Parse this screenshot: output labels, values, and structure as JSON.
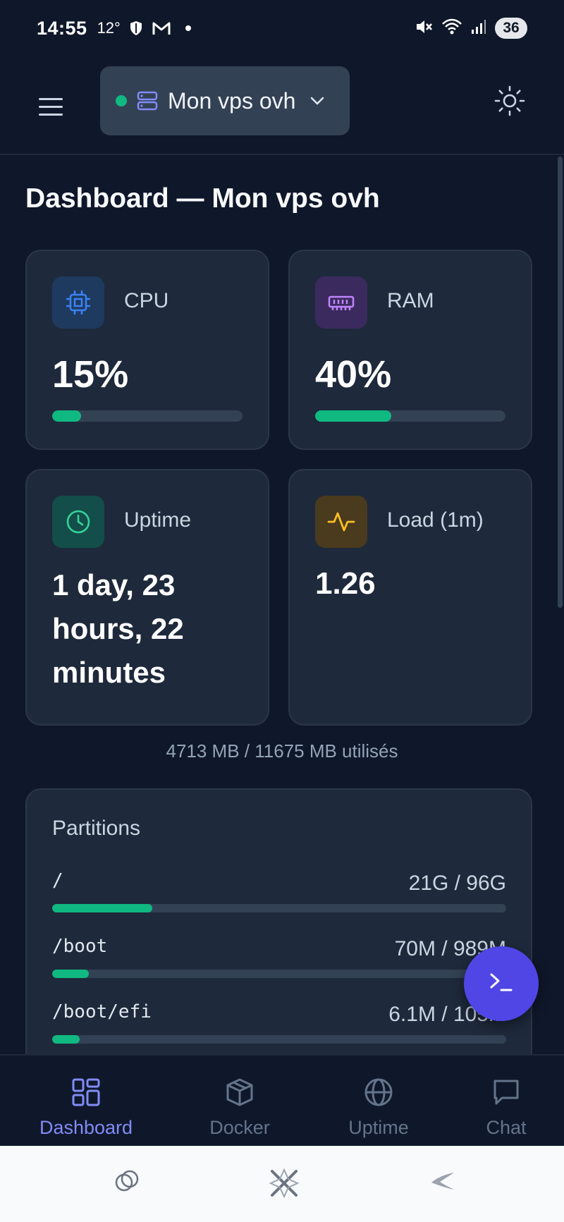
{
  "status_bar": {
    "time": "14:55",
    "temperature": "12°",
    "battery": "36"
  },
  "header": {
    "server_name": "Mon vps ovh",
    "server_status_color": "#10b981"
  },
  "page": {
    "title": "Dashboard — Mon vps ovh"
  },
  "cards": {
    "cpu": {
      "label": "CPU",
      "value": "15%",
      "percent": 15,
      "icon": "cpu-chip-icon",
      "accent": "#3b82f6"
    },
    "ram": {
      "label": "RAM",
      "value": "40%",
      "percent": 40,
      "icon": "memory-icon",
      "accent": "#a855f7"
    },
    "uptime": {
      "label": "Uptime",
      "value": "1 day, 23 hours, 22 minutes",
      "icon": "clock-icon",
      "accent": "#10b981"
    },
    "load": {
      "label": "Load (1m)",
      "value": "1.26",
      "icon": "activity-icon",
      "accent": "#f59e0b"
    }
  },
  "ram_note": "4713 MB / 11675 MB utilisés",
  "partitions": {
    "title": "Partitions",
    "items": [
      {
        "name": "/",
        "size": "21G / 96G",
        "percent": 22
      },
      {
        "name": "/boot",
        "size": "70M / 989M",
        "percent": 8
      },
      {
        "name": "/boot/efi",
        "size": "6.1M / 105M",
        "percent": 6
      }
    ]
  },
  "fab": {
    "icon": "terminal-icon"
  },
  "bottom_nav": {
    "items": [
      {
        "label": "Dashboard",
        "icon": "dashboard-icon",
        "active": true
      },
      {
        "label": "Docker",
        "icon": "docker-box-icon",
        "active": false
      },
      {
        "label": "Uptime",
        "icon": "globe-icon",
        "active": false
      },
      {
        "label": "Chat",
        "icon": "chat-icon",
        "active": false
      }
    ]
  },
  "colors": {
    "background": "#0f172a",
    "card": "#1e293b",
    "accent": "#818cf8",
    "progress": "#10b981",
    "fab": "#4f46e5"
  }
}
